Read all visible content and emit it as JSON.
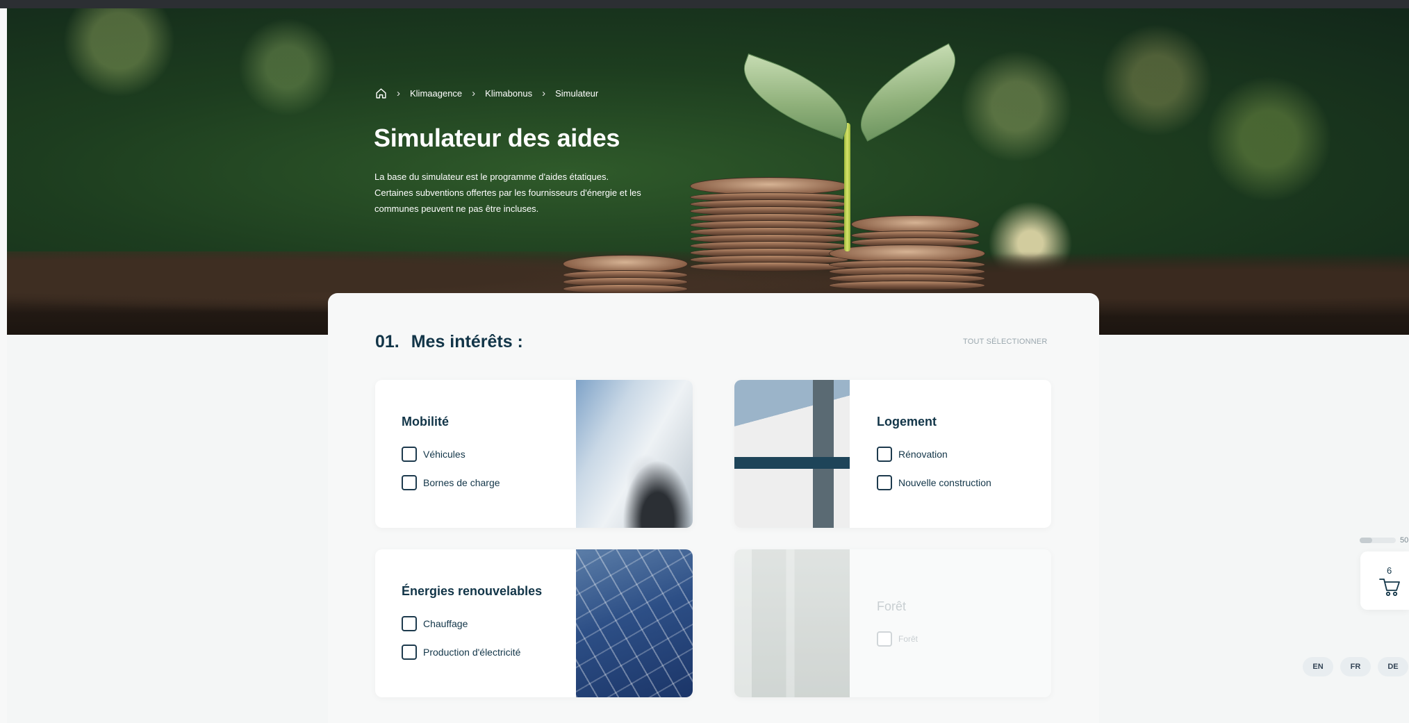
{
  "breadcrumb": {
    "home_icon": "home-icon",
    "items": [
      "Klimaagence",
      "Klimabonus",
      "Simulateur"
    ]
  },
  "hero": {
    "title": "Simulateur des aides",
    "description_lines": [
      "La base du simulateur est le programme d'aides étatiques.",
      "Certaines subventions offertes par les fournisseurs d'énergie et les",
      "communes peuvent ne pas être incluses."
    ]
  },
  "section": {
    "number": "01.",
    "title": "Mes intérêts :",
    "select_all": "TOUT SÉLECTIONNER"
  },
  "cards": {
    "mobilite": {
      "title": "Mobilité",
      "options": [
        "Véhicules",
        "Bornes de charge"
      ]
    },
    "logement": {
      "title": "Logement",
      "options": [
        "Rénovation",
        "Nouvelle construction"
      ]
    },
    "energies": {
      "title": "Énergies renouvelables",
      "options": [
        "Chauffage",
        "Production d'électricité"
      ]
    },
    "foret": {
      "title": "Forêt",
      "options": [
        "Forêt"
      ],
      "disabled": true
    }
  },
  "widgets": {
    "progress_label": "50",
    "progress_fraction": 0.35,
    "cart_count": "6",
    "cart_icon": "cart-icon",
    "languages": [
      "EN",
      "FR",
      "DE"
    ]
  },
  "colors": {
    "primary": "#123548",
    "muted": "#9aa7ae",
    "background": "#f4f6f6"
  }
}
